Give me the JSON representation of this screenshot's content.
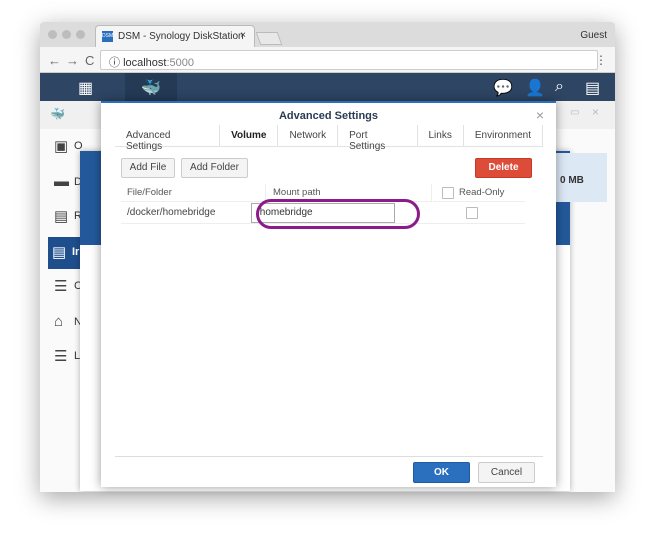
{
  "browser": {
    "tab_title": "DSM - Synology DiskStation",
    "tab_icon": "DSM",
    "user": "Guest",
    "url_host": "localhost",
    "url_port": ":5000"
  },
  "taskbar": {
    "icons": [
      "main-menu-icon",
      "docker-icon",
      "chat-icon",
      "user-icon",
      "search-icon",
      "widgets-icon"
    ]
  },
  "sidebar": {
    "items": [
      {
        "label": "O",
        "icon": "overview-icon"
      },
      {
        "label": "D",
        "icon": "dsm-icon"
      },
      {
        "label": "R",
        "icon": "registry-icon"
      },
      {
        "label": "Ir",
        "icon": "image-icon",
        "selected": true
      },
      {
        "label": "C",
        "icon": "container-icon"
      },
      {
        "label": "N",
        "icon": "network-icon"
      },
      {
        "label": "Lo",
        "icon": "log-icon"
      }
    ]
  },
  "background": {
    "size_text": "0 MB"
  },
  "dialog": {
    "title": "Advanced Settings",
    "tabs": [
      "Advanced Settings",
      "Volume",
      "Network",
      "Port Settings",
      "Links",
      "Environment"
    ],
    "active_tab": "Volume",
    "add_file": "Add File",
    "add_folder": "Add Folder",
    "delete": "Delete",
    "columns": {
      "file": "File/Folder",
      "mount": "Mount path",
      "readonly": "Read-Only"
    },
    "rows": [
      {
        "file": "/docker/homebridge",
        "mount": "/homebridge",
        "readonly": false
      }
    ],
    "ok": "OK",
    "cancel": "Cancel",
    "highlight_color": "#8b1a8b"
  }
}
